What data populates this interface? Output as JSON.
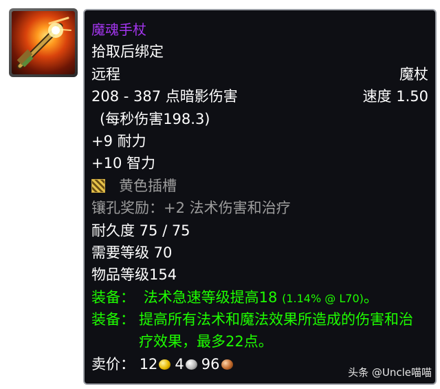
{
  "item": {
    "name": "魔魂手杖",
    "binding": "拾取后绑定",
    "slot": "远程",
    "type": "魔杖",
    "damage": "208 - 387 点暗影伤害",
    "speed": "速度 1.50",
    "dps": "(每秒伤害198.3)",
    "stats": [
      "+9 耐力",
      "+10 智力"
    ],
    "socket_label": "黄色插槽",
    "socket_bonus": "镶孔奖励：+2 法术伤害和治疗",
    "durability": "耐久度 75 / 75",
    "required_level": "需要等级 70",
    "item_level": "物品等级154",
    "equip1_prefix": "装备：",
    "equip1_text": "法术急速等级提高18",
    "equip1_detail": "(1.14% @ L70)",
    "equip1_end": "。",
    "equip2_prefix": "装备：",
    "equip2_text": "提高所有法术和魔法效果所造成的伤害和治疗效果，最多22点。",
    "sell_label": "卖价：",
    "sell_gold": "12",
    "sell_silver": "4",
    "sell_copper": "96",
    "icon_name": "flaming-wand-icon"
  },
  "watermark": "头条 @Uncle喵喵",
  "colors": {
    "item_name": "#a335ee",
    "equip_green": "#1eff00",
    "socket_grey": "#9d9d9d",
    "tooltip_bg": "#0e0f14"
  }
}
